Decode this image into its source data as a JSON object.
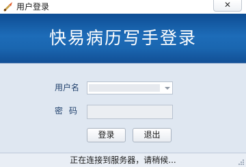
{
  "window": {
    "title": "用户登录",
    "close_symbol": "✕",
    "icons": {
      "app": "app-sword-icon",
      "close": "close-icon"
    }
  },
  "banner": {
    "title": "快易病历写手登录",
    "colors": {
      "top": "#0e4d93",
      "middle": "#1d6cb8"
    }
  },
  "form": {
    "username_label": "用户名",
    "password_label": "密码",
    "username_value": "",
    "password_value": ""
  },
  "buttons": {
    "login": "登录",
    "exit": "退出"
  },
  "status": {
    "text": "正在连接到服务器，请稍候..."
  }
}
